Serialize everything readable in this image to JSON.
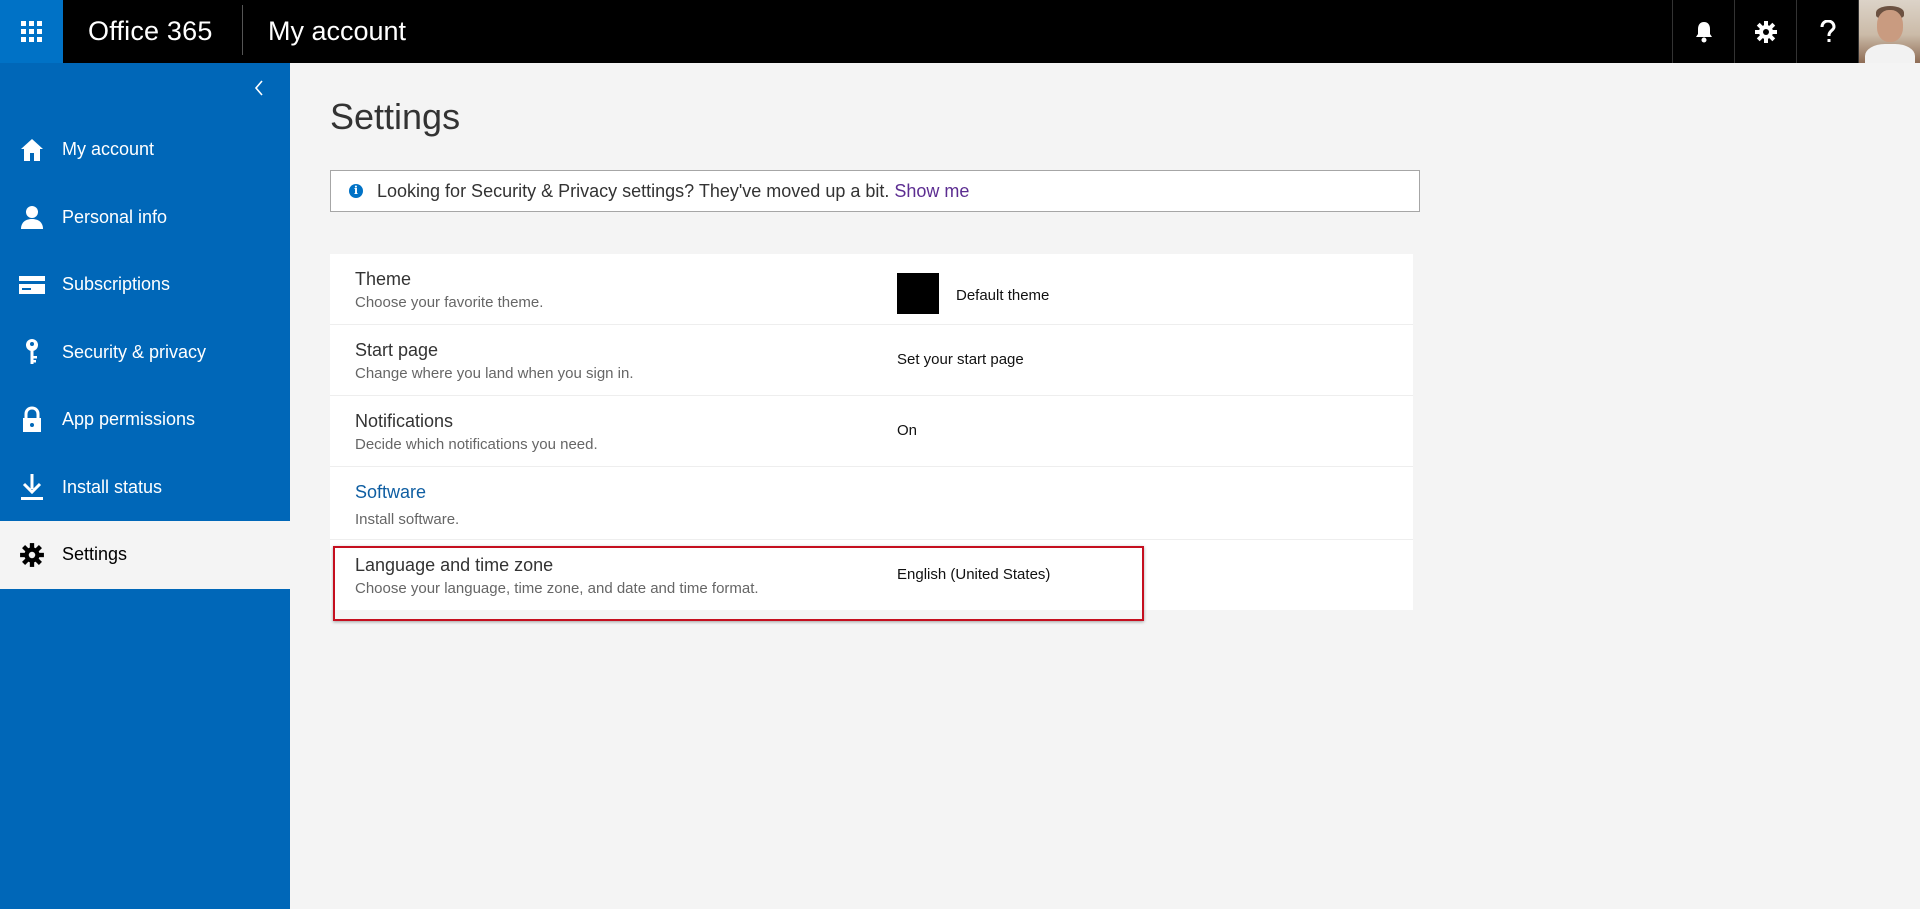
{
  "header": {
    "brand": "Office 365",
    "page": "My account"
  },
  "icons": {
    "app_launcher": "waffle-icon",
    "notifications": "bell-icon",
    "settings": "gear-icon",
    "help": "question-icon",
    "collapse": "chevron-left-icon",
    "info": "info-icon"
  },
  "sidebar": {
    "items": [
      {
        "label": "My account",
        "icon": "home-icon"
      },
      {
        "label": "Personal info",
        "icon": "person-icon"
      },
      {
        "label": "Subscriptions",
        "icon": "card-icon"
      },
      {
        "label": "Security & privacy",
        "icon": "key-icon"
      },
      {
        "label": "App permissions",
        "icon": "lock-icon"
      },
      {
        "label": "Install status",
        "icon": "download-icon"
      },
      {
        "label": "Settings",
        "icon": "gear-icon"
      }
    ],
    "active": "Settings"
  },
  "main": {
    "title": "Settings",
    "info": {
      "text": "Looking for Security & Privacy settings? They've moved up a bit.",
      "link": "Show me"
    },
    "settings": [
      {
        "title": "Theme",
        "desc": "Choose your favorite theme.",
        "value": "Default theme"
      },
      {
        "title": "Start page",
        "desc": "Change where you land when you sign in.",
        "value": "Set your start page"
      },
      {
        "title": "Notifications",
        "desc": "Decide which notifications you need.",
        "value": "On"
      },
      {
        "title": "Software",
        "desc": "Install software.",
        "value": ""
      },
      {
        "title": "Language and time zone",
        "desc": "Choose your language, time zone, and date and time format.",
        "value": "English (United States)"
      }
    ]
  },
  "colors": {
    "accent": "#0072c6",
    "sidebar": "#0067b8",
    "topbar": "#000000",
    "highlight": "#c50f1f",
    "link": "#5c2d91"
  }
}
